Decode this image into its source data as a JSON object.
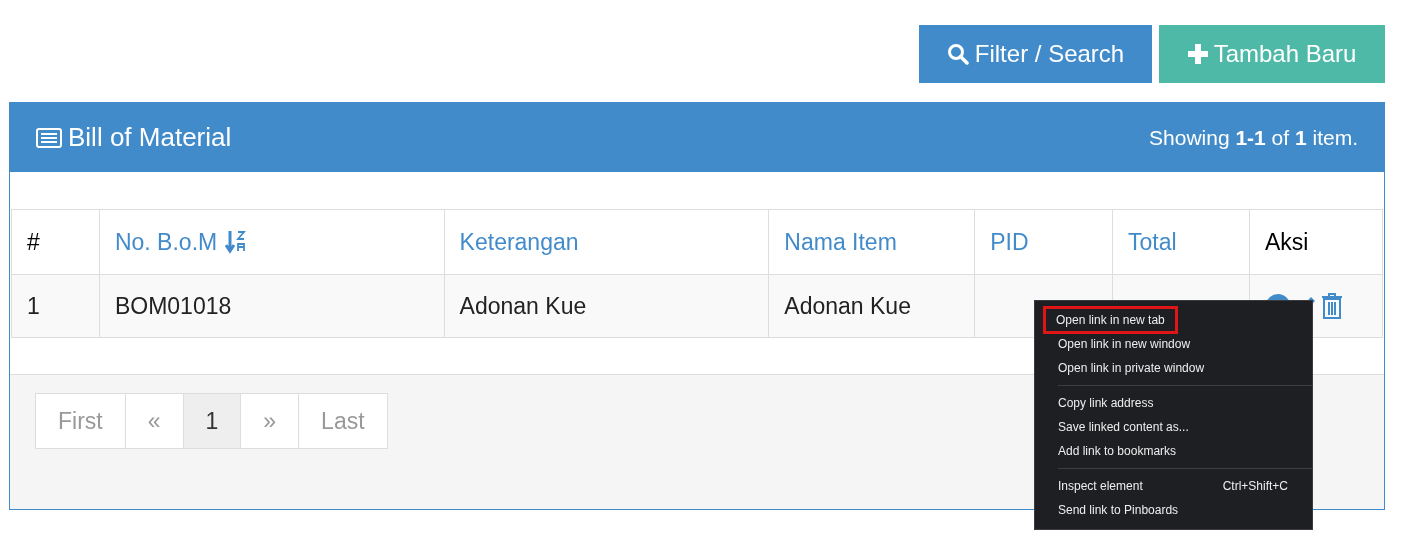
{
  "toolbar": {
    "buttons": [
      {
        "label": "Filter / Search",
        "kind": "search"
      },
      {
        "label": "Tambah Baru",
        "kind": "add"
      }
    ]
  },
  "panel": {
    "title": "Bill of Material",
    "summary": "Showing **1-1** of **1** item."
  },
  "table": {
    "columns": [
      {
        "label": "#",
        "sortable": false
      },
      {
        "label": "No. B.o.M",
        "sortable": true,
        "sorted": true
      },
      {
        "label": "Keterangan",
        "sortable": true,
        "sorted": false
      },
      {
        "label": "Nama Item",
        "sortable": true,
        "sorted": false
      },
      {
        "label": "PID",
        "sortable": true,
        "sorted": false
      },
      {
        "label": "Total",
        "sortable": true,
        "sorted": false
      },
      {
        "label": "Aksi",
        "sortable": false
      }
    ],
    "rows": [
      {
        "cells": [
          "1",
          "BOM01018",
          "Adonan Kue",
          "Adonan Kue",
          ""
        ]
      }
    ]
  },
  "pagination": [
    {
      "label": "First",
      "selected": false
    },
    {
      "label": "«",
      "selected": false
    },
    {
      "label": "1",
      "selected": true
    },
    {
      "label": "»",
      "selected": false
    },
    {
      "label": "Last",
      "selected": false
    }
  ],
  "context_menu": {
    "items": [
      {
        "kind": "item",
        "label": "Open link in new tab",
        "outlined": true
      },
      {
        "kind": "item",
        "label": "Open link in new window",
        "outlined": false
      },
      {
        "kind": "item",
        "label": "Open link in private window",
        "outlined": false
      },
      {
        "kind": "separator"
      },
      {
        "kind": "item",
        "label": "Copy link address",
        "outlined": false
      },
      {
        "kind": "item",
        "label": "Save linked content as...",
        "outlined": false
      },
      {
        "kind": "item",
        "label": "Add link to bookmarks",
        "outlined": false
      },
      {
        "kind": "separator"
      },
      {
        "kind": "item",
        "label": "Inspect element",
        "shortcut": "Ctrl+Shift+C",
        "outlined": false
      },
      {
        "kind": "item",
        "label": "Send link to Pinboards",
        "outlined": false
      }
    ]
  }
}
